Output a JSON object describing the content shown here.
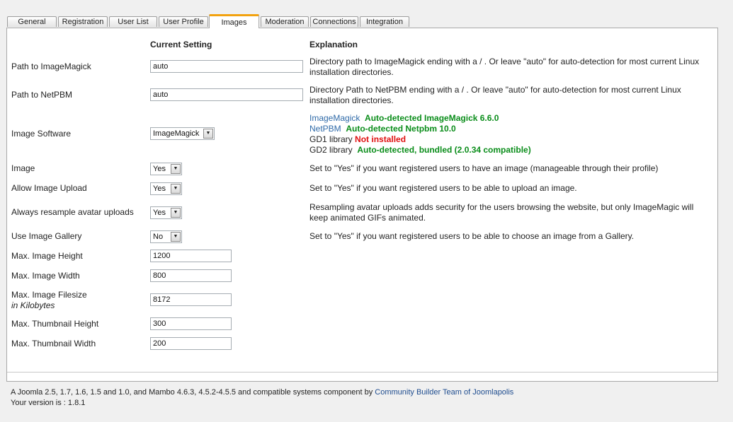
{
  "tabs": [
    "General",
    "Registration",
    "User List",
    "User Profile",
    "Images",
    "Moderation",
    "Connections",
    "Integration"
  ],
  "headers": {
    "current": "Current Setting",
    "explanation": "Explanation"
  },
  "rows": {
    "imagemagick_path": {
      "label": "Path to ImageMagick",
      "value": "auto",
      "explanation": "Directory path to ImageMagick ending with a / . Or leave \"auto\" for auto-detection for most current Linux installation directories."
    },
    "netpbm_path": {
      "label": "Path to NetPBM",
      "value": "auto",
      "explanation": "Directory Path to NetPBM ending with a / . Or leave \"auto\" for auto-detection for most current Linux installation directories."
    },
    "image_software": {
      "label": "Image Software",
      "value": "ImageMagick",
      "status": {
        "imagemagick_name": "ImageMagick",
        "imagemagick_status": "Auto-detected ImageMagick 6.6.0",
        "netpbm_name": "NetPBM",
        "netpbm_status": "Auto-detected Netpbm 10.0",
        "gd1_name": "GD1 library",
        "gd1_status": "Not installed",
        "gd2_name": "GD2 library",
        "gd2_status": "Auto-detected, bundled (2.0.34 compatible)"
      }
    },
    "image": {
      "label": "Image",
      "value": "Yes",
      "explanation": "Set to \"Yes\" if you want registered users to have an image (manageable through their profile)"
    },
    "allow_upload": {
      "label": "Allow Image Upload",
      "value": "Yes",
      "explanation": "Set to \"Yes\" if you want registered users to be able to upload an image."
    },
    "resample": {
      "label": "Always resample avatar uploads",
      "value": "Yes",
      "explanation": "Resampling avatar uploads adds security for the users browsing the website, but only ImageMagic will keep animated GIFs animated."
    },
    "gallery": {
      "label": "Use Image Gallery",
      "value": "No",
      "explanation": "Set to \"Yes\" if you want registered users to be able to choose an image from a Gallery."
    },
    "max_height": {
      "label": "Max. Image Height",
      "value": "1200"
    },
    "max_width": {
      "label": "Max. Image Width",
      "value": "800"
    },
    "max_filesize": {
      "label": "Max. Image Filesize",
      "sublabel": "in Kilobytes",
      "value": "8172"
    },
    "thumb_height": {
      "label": "Max. Thumbnail Height",
      "value": "300"
    },
    "thumb_width": {
      "label": "Max. Thumbnail Width",
      "value": "200"
    }
  },
  "footer": {
    "line1_text": "A Joomla 2.5, 1.7, 1.6, 1.5 and 1.0, and Mambo 4.6.3, 4.5.2-4.5.5 and compatible systems component by",
    "line1_link": "Community Builder Team of Joomlapolis",
    "version": "Your version is : 1.8.1"
  },
  "colors": {
    "active_tab_accent": "#f2a20f",
    "detected": "#0a8d1a",
    "missing": "#e01010",
    "link": "#2f6aa8"
  }
}
